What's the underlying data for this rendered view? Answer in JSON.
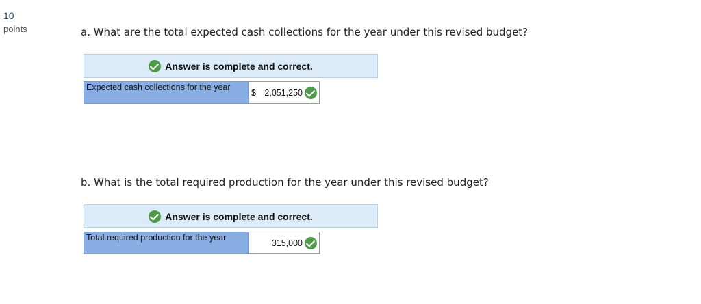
{
  "points": {
    "value": "10",
    "label": "points"
  },
  "part_a": {
    "question": "a. What are the total expected cash collections for the year under this revised budget?",
    "banner": "Answer is complete and correct.",
    "row_label": "Expected cash collections for the year",
    "currency": "$",
    "answer": "2,051,250"
  },
  "part_b": {
    "question": "b. What is the total required production for the year under this revised budget?",
    "banner": "Answer is complete and correct.",
    "row_label": "Total required production for the year",
    "answer": "315,000"
  },
  "icons": {
    "correct": "check-circle-icon",
    "correct_color": "#4f9a4a"
  }
}
